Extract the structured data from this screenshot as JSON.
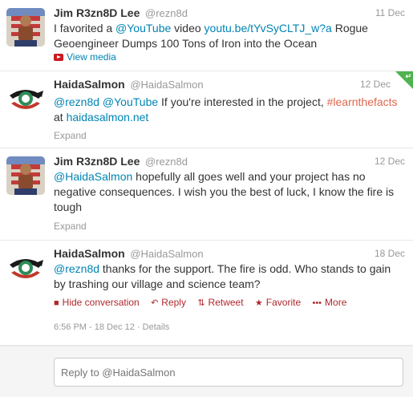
{
  "tweets": [
    {
      "name": "Jim R3zn8D Lee",
      "handle": "@rezn8d",
      "date": "11 Dec",
      "text_parts": [
        "I favorited a ",
        "@YouTube",
        " video ",
        "youtu.be/tYvSyCLTJ_w?a",
        " Rogue Geoengineer Dumps 100 Tons of Iron into the Ocean"
      ],
      "action": "View media"
    },
    {
      "name": "HaidaSalmon",
      "handle": "@HaidaSalmon",
      "date": "12 Dec",
      "text_parts": [
        "@rezn8d",
        " ",
        "@YouTube",
        " If you're interested in the project, ",
        "#learnthefacts",
        " at ",
        "haidasalmon.net"
      ],
      "action": "Expand"
    },
    {
      "name": "Jim R3zn8D Lee",
      "handle": "@rezn8d",
      "date": "12 Dec",
      "text_parts": [
        "@HaidaSalmon",
        " hopefully all goes well and your project has no negative consequences. I wish you the best of luck, I know the fire is tough"
      ],
      "action": "Expand"
    },
    {
      "name": "HaidaSalmon",
      "handle": "@HaidaSalmon",
      "date": "18 Dec",
      "text_parts": [
        "@rezn8d",
        " thanks for the support. The fire is odd. Who stands to gain by trashing our village and science team?"
      ],
      "actions": [
        "Hide conversation",
        "Reply",
        "Retweet",
        "Favorite",
        "More"
      ],
      "meta": "6:56 PM - 18 Dec 12 · Details"
    }
  ],
  "reply": {
    "placeholder": "Reply to @HaidaSalmon"
  },
  "colors": {
    "link": "#0084b4",
    "hashtag": "#e0674f",
    "action_red": "#b0282d",
    "followed_corner": "#4fb34f"
  },
  "icons": [
    "youtube-icon",
    "speech-bubble-icon",
    "reply-arrow-icon",
    "retweet-icon",
    "star-icon",
    "dots-icon"
  ]
}
